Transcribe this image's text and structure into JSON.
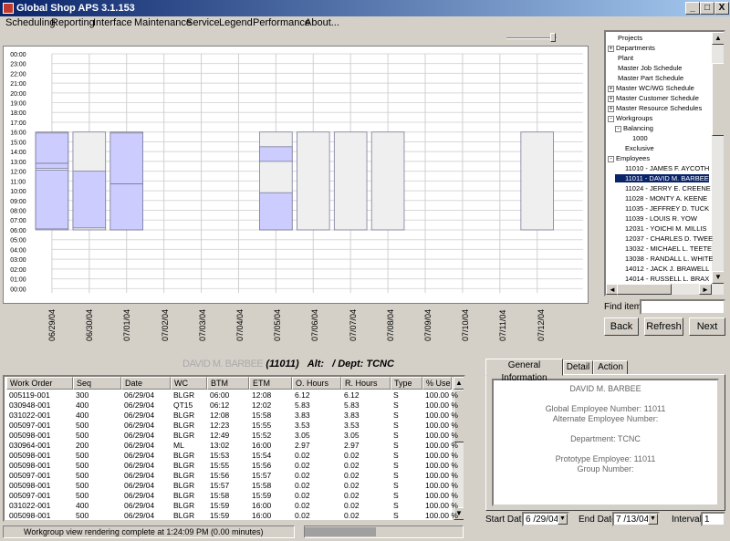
{
  "window": {
    "title": "Global Shop APS 3.1.153",
    "controls": [
      "_",
      "□",
      "X"
    ]
  },
  "menu": [
    "Scheduling",
    "Reporting",
    "Interface",
    "Maintenance",
    "Service",
    "Legend",
    "Performance",
    "About..."
  ],
  "gantt": {
    "time_labels": [
      "00:00",
      "23:00",
      "22:00",
      "21:00",
      "20:00",
      "19:00",
      "18:00",
      "17:00",
      "16:00",
      "15:00",
      "14:00",
      "13:00",
      "12:00",
      "11:00",
      "10:00",
      "09:00",
      "08:00",
      "07:00",
      "06:00",
      "05:00",
      "04:00",
      "03:00",
      "02:00",
      "01:00",
      "00:00"
    ],
    "dates": [
      "06/29/04",
      "06/30/04",
      "07/01/04",
      "07/02/04",
      "07/03/04",
      "07/04/04",
      "07/05/04",
      "07/06/04",
      "07/07/04",
      "07/08/04",
      "07/09/04",
      "07/10/04",
      "07/11/04",
      "07/12/04"
    ],
    "work_fill": "#ccccff",
    "empty_fill": "#efefef"
  },
  "tree": {
    "items": [
      {
        "label": "Projects",
        "level": 1,
        "toggle": ""
      },
      {
        "label": "Departments",
        "level": 1,
        "toggle": "+"
      },
      {
        "label": "Plant",
        "level": 1,
        "toggle": ""
      },
      {
        "label": "Master Job Schedule",
        "level": 1,
        "toggle": ""
      },
      {
        "label": "Master Part Schedule",
        "level": 1,
        "toggle": ""
      },
      {
        "label": "Master WC/WG Schedule",
        "level": 1,
        "toggle": "+"
      },
      {
        "label": "Master Customer Schedule",
        "level": 1,
        "toggle": "+"
      },
      {
        "label": "Master Resource Schedules",
        "level": 1,
        "toggle": "+"
      },
      {
        "label": "Workgroups",
        "level": 1,
        "toggle": "-"
      },
      {
        "label": "Balancing",
        "level": 2,
        "toggle": "-"
      },
      {
        "label": "1000",
        "level": 3,
        "toggle": ""
      },
      {
        "label": "Exclusive",
        "level": 2,
        "toggle": ""
      },
      {
        "label": "Employees",
        "level": 1,
        "toggle": "-"
      },
      {
        "label": "11010 - JAMES F. AYCOTH",
        "level": 2,
        "toggle": ""
      },
      {
        "label": "11011 - DAVID M. BARBEE",
        "level": 2,
        "toggle": "",
        "selected": true
      },
      {
        "label": "11024 - JERRY E. CREENE",
        "level": 2,
        "toggle": ""
      },
      {
        "label": "11028 - MONTY A. KEENE",
        "level": 2,
        "toggle": ""
      },
      {
        "label": "11035 - JEFFREY D. TUCK",
        "level": 2,
        "toggle": ""
      },
      {
        "label": "11039 - LOUIS R. YOW",
        "level": 2,
        "toggle": ""
      },
      {
        "label": "12031 - YOICHI M. MILLIS",
        "level": 2,
        "toggle": ""
      },
      {
        "label": "12037 - CHARLES D. TWEE",
        "level": 2,
        "toggle": ""
      },
      {
        "label": "13032 - MICHAEL L. TEETE",
        "level": 2,
        "toggle": ""
      },
      {
        "label": "13038 - RANDALL L. WHITE",
        "level": 2,
        "toggle": ""
      },
      {
        "label": "14012 - JACK J. BRAWELL",
        "level": 2,
        "toggle": ""
      },
      {
        "label": "14014 - RUSSELL L. BRAX",
        "level": 2,
        "toggle": ""
      }
    ]
  },
  "find": {
    "label": "Find item",
    "value": ""
  },
  "nav_buttons": {
    "back": "Back",
    "refresh": "Refresh",
    "next": "Next"
  },
  "heading": {
    "name": "DAVID M. BARBEE",
    "id": "(11011)",
    "alt": "Alt:",
    "dept": "/ Dept: TCNC"
  },
  "table": {
    "columns": [
      "Work Order",
      "Seq",
      "Date",
      "WC",
      "BTM",
      "ETM",
      "O. Hours",
      "R. Hours",
      "Type",
      "% Use"
    ],
    "rows": [
      [
        "005119-001",
        "300",
        "06/29/04",
        "BLGR",
        "06:00",
        "12:08",
        "6.12",
        "6.12",
        "S",
        "100.00 %"
      ],
      [
        "030948-001",
        "400",
        "06/29/04",
        "QT15",
        "06:12",
        "12:02",
        "5.83",
        "5.83",
        "S",
        "100.00 %"
      ],
      [
        "031022-001",
        "400",
        "06/29/04",
        "BLGR",
        "12:08",
        "15:58",
        "3.83",
        "3.83",
        "S",
        "100.00 %"
      ],
      [
        "005097-001",
        "500",
        "06/29/04",
        "BLGR",
        "12:23",
        "15:55",
        "3.53",
        "3.53",
        "S",
        "100.00 %"
      ],
      [
        "005098-001",
        "500",
        "06/29/04",
        "BLGR",
        "12:49",
        "15:52",
        "3.05",
        "3.05",
        "S",
        "100.00 %"
      ],
      [
        "030964-001",
        "200",
        "06/29/04",
        "ML",
        "13:02",
        "16:00",
        "2.97",
        "2.97",
        "S",
        "100.00 %"
      ],
      [
        "005098-001",
        "500",
        "06/29/04",
        "BLGR",
        "15:53",
        "15:54",
        "0.02",
        "0.02",
        "S",
        "100.00 %"
      ],
      [
        "005098-001",
        "500",
        "06/29/04",
        "BLGR",
        "15:55",
        "15:56",
        "0.02",
        "0.02",
        "S",
        "100.00 %"
      ],
      [
        "005097-001",
        "500",
        "06/29/04",
        "BLGR",
        "15:56",
        "15:57",
        "0.02",
        "0.02",
        "S",
        "100.00 %"
      ],
      [
        "005098-001",
        "500",
        "06/29/04",
        "BLGR",
        "15:57",
        "15:58",
        "0.02",
        "0.02",
        "S",
        "100.00 %"
      ],
      [
        "005097-001",
        "500",
        "06/29/04",
        "BLGR",
        "15:58",
        "15:59",
        "0.02",
        "0.02",
        "S",
        "100.00 %"
      ],
      [
        "031022-001",
        "400",
        "06/29/04",
        "BLGR",
        "15:59",
        "16:00",
        "0.02",
        "0.02",
        "S",
        "100.00 %"
      ],
      [
        "005098-001",
        "500",
        "06/29/04",
        "BLGR",
        "15:59",
        "16:00",
        "0.02",
        "0.02",
        "S",
        "100.00 %"
      ]
    ]
  },
  "tabs": [
    "General Information",
    "Detail",
    "Action"
  ],
  "info": {
    "name": "DAVID M. BARBEE",
    "global_number": "Global Employee Number: 11011",
    "alternate_number": "Alternate Employee Number:",
    "department": "Department: TCNC",
    "prototype": "Prototype Employee: 11011",
    "group_number": "Group Number:"
  },
  "dates_filter": {
    "start_label": "Start Date",
    "start_value": "6 /29/04",
    "end_label": "End Date",
    "end_value": "7 /13/04",
    "interval_label": "Interval",
    "interval_value": "1"
  },
  "status": {
    "text": "Workgroup view rendering complete at 1:24:09 PM  (0.00 minutes)",
    "progress": 0.45
  }
}
